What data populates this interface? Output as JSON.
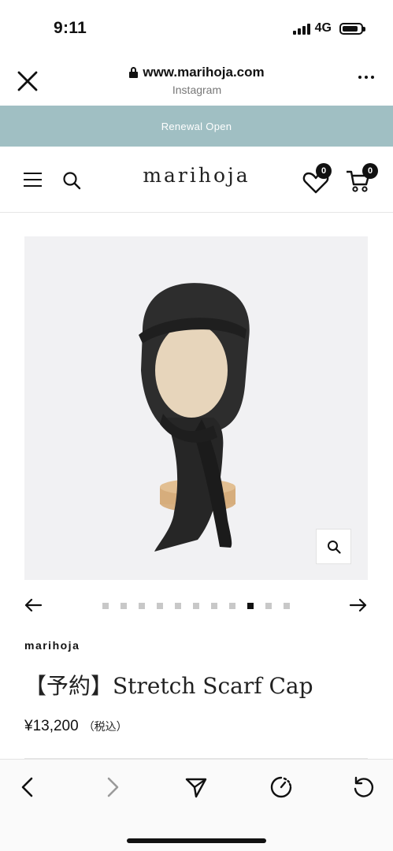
{
  "status_bar": {
    "time": "9:11",
    "network": "4G"
  },
  "browser": {
    "url": "www.marihoja.com",
    "source": "Instagram"
  },
  "banner": {
    "text": "Renewal Open"
  },
  "site_header": {
    "logo": "marihoja",
    "wishlist_count": "0",
    "cart_count": "0"
  },
  "carousel": {
    "total": 11,
    "active_index": 8
  },
  "product": {
    "vendor": "marihoja",
    "title": "【予約】Stretch Scarf Cap",
    "price": "¥13,200",
    "tax_note": "（税込）"
  },
  "colors": {
    "banner_bg": "#a0bfc3",
    "image_bg": "#f1f1f3"
  },
  "icons": [
    "close-icon",
    "lock-icon",
    "more-icon",
    "menu-icon",
    "search-icon",
    "heart-icon",
    "cart-icon",
    "zoom-icon",
    "arrow-left-icon",
    "arrow-right-icon",
    "back-icon",
    "forward-icon",
    "share-icon",
    "speed-icon",
    "reload-icon"
  ]
}
